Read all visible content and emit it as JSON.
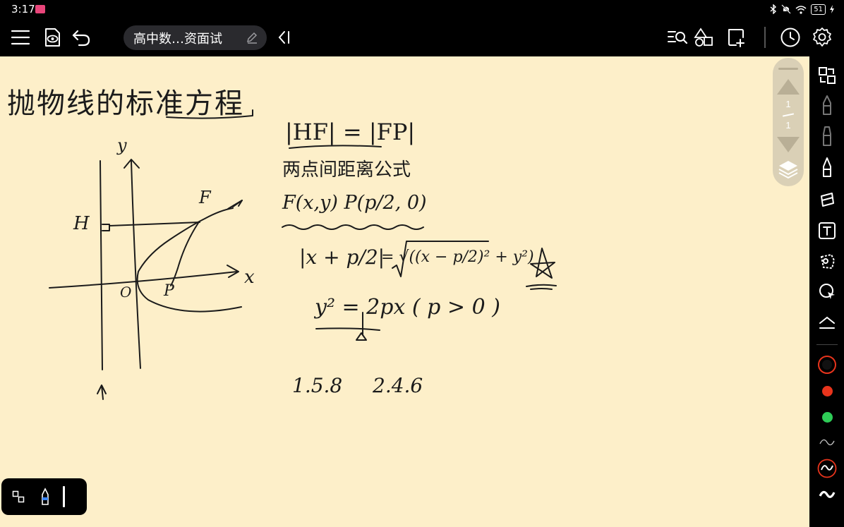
{
  "status_bar": {
    "time": "3:17",
    "battery": "51"
  },
  "toolbar": {
    "document_title": "高中数…资面试"
  },
  "page_indicator": {
    "current": "1",
    "total": "1"
  },
  "notes": {
    "title": "抛物线的标准方程",
    "line_hf_fp": "|HF| = |FP|",
    "line_distance_formula": "两点间距离公式",
    "line_coordinates": "F(x,y)    P(p/2, 0)",
    "line_equation_lhs": "|x + p/2|",
    "line_equation_rhs": "= √((x − p/2)² + y²)",
    "line_standard_form": "y² = 2px  ( p > 0 )",
    "line_numbers_a": "1.5.8",
    "line_numbers_b": "2.4.6",
    "axis_y": "y",
    "axis_x": "x",
    "label_H": "H",
    "label_F": "F",
    "label_O": "O",
    "label_P": "P"
  },
  "colors": {
    "canvas": "#fdefc9",
    "ink": "#1b1b1b",
    "red": "#e8341c",
    "green": "#2ecc57",
    "toolbar": "#000000"
  },
  "icons": {
    "toolbar_left": [
      "menu-icon",
      "preview-icon",
      "undo-icon"
    ],
    "toolbar_right": [
      "search-list-icon",
      "shapes-icon",
      "add-page-icon",
      "history-icon",
      "settings-icon"
    ],
    "rail": [
      "switch-panel-icon",
      "pen-icon",
      "pencil-icon",
      "marker-icon",
      "eraser-icon",
      "text-icon",
      "lasso-icon",
      "select-icon",
      "collapse-icon"
    ]
  }
}
